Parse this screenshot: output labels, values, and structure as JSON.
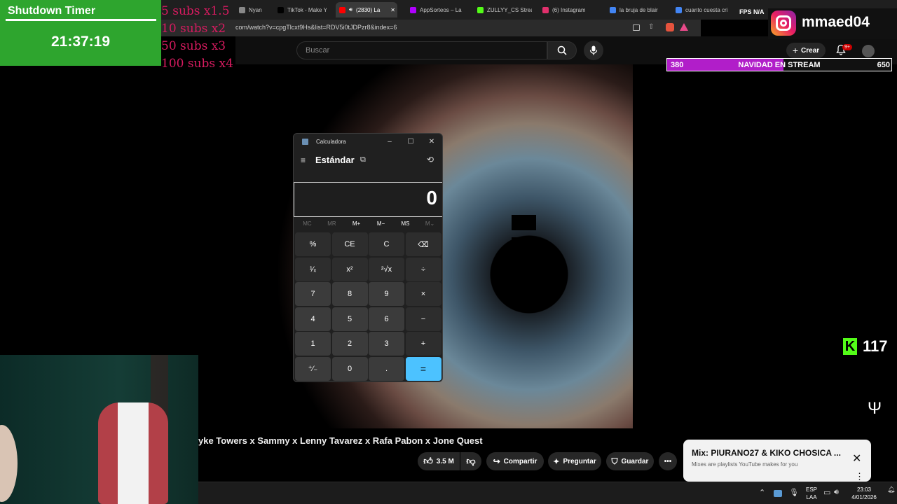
{
  "browser": {
    "tabs": [
      {
        "label": "Nyan Nya",
        "favicon": "nyan-favicon",
        "color": "#888888"
      },
      {
        "label": "TikTok - Make Yo",
        "favicon": "tiktok-favicon",
        "color": "#000000"
      },
      {
        "label": "(2830) La",
        "favicon": "youtube-favicon",
        "color": "#ff0000"
      },
      {
        "label": "AppSorteos – La",
        "favicon": "appsorteos-favicon",
        "color": "#b000ff"
      },
      {
        "label": "ZULLYY_CS Strea",
        "favicon": "kick-favicon",
        "color": "#53fc18"
      },
      {
        "label": "(6) Instagram",
        "favicon": "instagram-favicon",
        "color": "#e1306c"
      },
      {
        "label": "la bruja de blair",
        "favicon": "google-favicon",
        "color": "#4285f4"
      },
      {
        "label": "cuanto cuesta cri",
        "favicon": "google-favicon",
        "color": "#4285f4"
      }
    ],
    "url": "com/watch?v=cpgTlcxt9Hs&list=RDV5i0tJDPzr8&index=6"
  },
  "youtube": {
    "search_placeholder": "Buscar",
    "create_label": "Crear",
    "notif_badge": "9+",
    "video_title": "yke Towers x Sammy x Lenny Tavarez x Rafa Pabon x Jone Quest",
    "likes": "3.5 M",
    "share_label": "Compartir",
    "ask_label": "Preguntar",
    "save_label": "Guardar",
    "mix_title": "Mix: PIURANO27 & KIKO CHOSICA ...",
    "mix_subtitle": "Mixes are playlists YouTube makes for you"
  },
  "overlay": {
    "shutdown_title": "Shutdown Timer",
    "shutdown_time": "21:37:19",
    "subs": [
      "5 subs x1.5",
      "10 subs x2",
      "50 subs x3",
      "100 subs x4"
    ],
    "instagram_handle": "mmaed04",
    "fps_text": "FPS N/A",
    "goal": {
      "start": "380",
      "label": "NAVIDAD EN STREAM",
      "end": "650",
      "progress": 0.52
    },
    "kick_count": "117"
  },
  "calculator": {
    "title": "Calculadora",
    "mode": "Estándar",
    "display": "0",
    "memory": [
      "MC",
      "MR",
      "M+",
      "M−",
      "MS",
      "M⌄"
    ],
    "memory_enabled": [
      false,
      false,
      true,
      true,
      true,
      false
    ],
    "keys": [
      [
        "%",
        "CE",
        "C",
        "⌫"
      ],
      [
        "¹⁄ₓ",
        "x²",
        "²√x",
        "÷"
      ],
      [
        "7",
        "8",
        "9",
        "×"
      ],
      [
        "4",
        "5",
        "6",
        "−"
      ],
      [
        "1",
        "2",
        "3",
        "+"
      ],
      [
        "⁺⁄₋",
        "0",
        ".",
        "="
      ]
    ]
  },
  "taskbar": {
    "lang_top": "ESP",
    "lang_bottom": "LAA",
    "time": "23:03",
    "date": "4/01/2026"
  },
  "colors": {
    "shutdown_green": "#2ea52e",
    "subs_pink": "#d81b60",
    "goal_purple": "#b11ec9",
    "kick_green": "#53fc18",
    "calc_accent": "#4cc2ff"
  }
}
